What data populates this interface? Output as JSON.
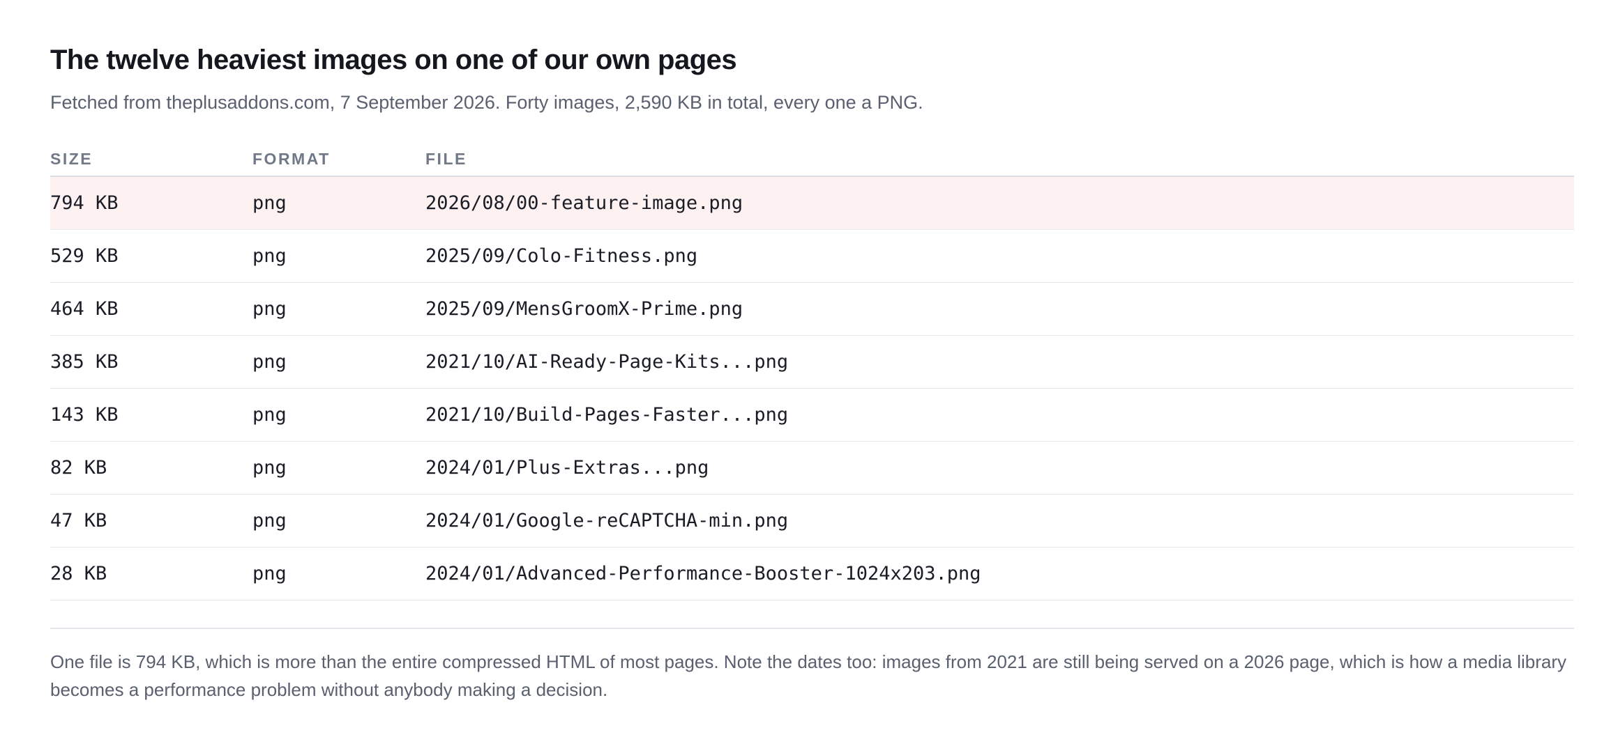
{
  "title": "The twelve heaviest images on one of our own pages",
  "subtitle": "Fetched from theplusaddons.com, 7 September 2026. Forty images, 2,590 KB in total, every one a PNG.",
  "table": {
    "headers": [
      "SIZE",
      "FORMAT",
      "FILE"
    ],
    "rows": [
      {
        "size": "794 KB",
        "format": "png",
        "file": "2026/08/00-feature-image.png",
        "highlight": true
      },
      {
        "size": "529 KB",
        "format": "png",
        "file": "2025/09/Colo-Fitness.png",
        "highlight": false
      },
      {
        "size": "464 KB",
        "format": "png",
        "file": "2025/09/MensGroomX-Prime.png",
        "highlight": false
      },
      {
        "size": "385 KB",
        "format": "png",
        "file": "2021/10/AI-Ready-Page-Kits...png",
        "highlight": false
      },
      {
        "size": "143 KB",
        "format": "png",
        "file": "2021/10/Build-Pages-Faster...png",
        "highlight": false
      },
      {
        "size": "82 KB",
        "format": "png",
        "file": "2024/01/Plus-Extras...png",
        "highlight": false
      },
      {
        "size": "47 KB",
        "format": "png",
        "file": "2024/01/Google-reCAPTCHA-min.png",
        "highlight": false
      },
      {
        "size": "28 KB",
        "format": "png",
        "file": "2024/01/Advanced-Performance-Booster-1024x203.png",
        "highlight": false
      }
    ]
  },
  "footnote": "One file is 794 KB, which is more than the entire compressed HTML of most pages. Note the dates too: images from 2021 are still being served on a 2026 page, which is how a media library becomes a performance problem without anybody making a decision.",
  "colors": {
    "highlight_row": "#fdf1f1",
    "text": "#1a1d26",
    "muted": "#5a6070"
  }
}
